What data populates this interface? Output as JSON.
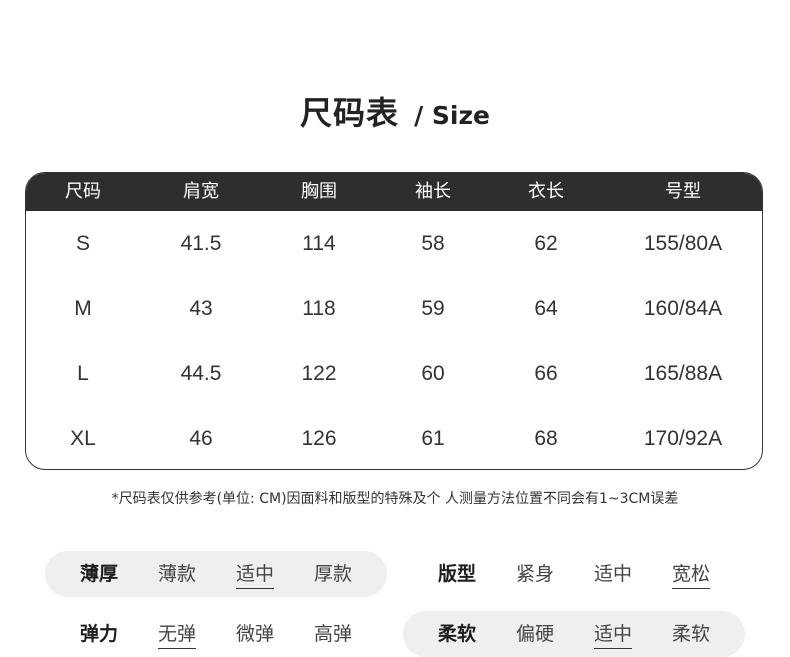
{
  "title": {
    "main": "尺码表",
    "sub": "/ Size"
  },
  "table": {
    "headers": [
      "尺码",
      "肩宽",
      "胸围",
      "袖长",
      "衣长",
      "号型"
    ],
    "rows": [
      [
        "S",
        "41.5",
        "114",
        "58",
        "62",
        "155/80A"
      ],
      [
        "M",
        "43",
        "118",
        "59",
        "64",
        "160/84A"
      ],
      [
        "L",
        "44.5",
        "122",
        "60",
        "66",
        "165/88A"
      ],
      [
        "XL",
        "46",
        "126",
        "61",
        "68",
        "170/92A"
      ]
    ]
  },
  "footnote": "*尺码表仅供参考(单位: CM)因面料和版型的特殊及个 人测量方法位置不同会有1~3CM误差",
  "attributes": {
    "thickness": {
      "label": "薄厚",
      "options": [
        "薄款",
        "适中",
        "厚款"
      ],
      "selected": "适中"
    },
    "fit": {
      "label": "版型",
      "options": [
        "紧身",
        "适中",
        "宽松"
      ],
      "selected": "宽松"
    },
    "elasticity": {
      "label": "弹力",
      "options": [
        "无弹",
        "微弹",
        "高弹"
      ],
      "selected": "无弹"
    },
    "softness": {
      "label": "柔软",
      "options": [
        "偏硬",
        "适中",
        "柔软"
      ],
      "selected": "适中"
    }
  }
}
